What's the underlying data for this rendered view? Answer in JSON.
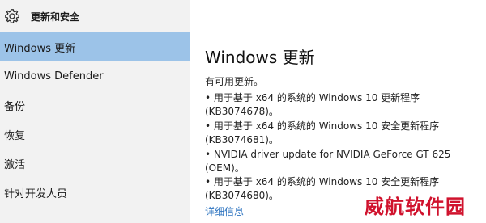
{
  "nav": {
    "title": "更新和安全",
    "items": [
      {
        "label": "Windows 更新"
      },
      {
        "label": "Windows Defender"
      },
      {
        "label": "备份"
      },
      {
        "label": "恢复"
      },
      {
        "label": "激活"
      },
      {
        "label": "针对开发人员"
      }
    ]
  },
  "main": {
    "title": "Windows 更新",
    "status": "有可用更新。",
    "updates": [
      {
        "line1": "• 用于基于 x64 的系统的 Windows 10 更新程序",
        "line2": "(KB3074678)。"
      },
      {
        "line1": "• 用于基于 x64 的系统的 Windows 10 安全更新程序",
        "line2": "(KB3074681)。"
      },
      {
        "line1": "• NVIDIA driver update for NVIDIA GeForce GT 625",
        "line2": "(OEM)。"
      },
      {
        "line1": "• 用于基于 x64 的系统的 Windows 10 安全更新程序",
        "line2": "(KB3074680)。"
      }
    ],
    "details_link": "详细信息"
  },
  "watermark": "威航软件园",
  "colors": {
    "nav_background": "#f2f2f2",
    "selected_background": "#9cc3e8",
    "link": "#2e74c0",
    "watermark": "#d0122d"
  },
  "icons": {
    "header": "gear-icon"
  }
}
